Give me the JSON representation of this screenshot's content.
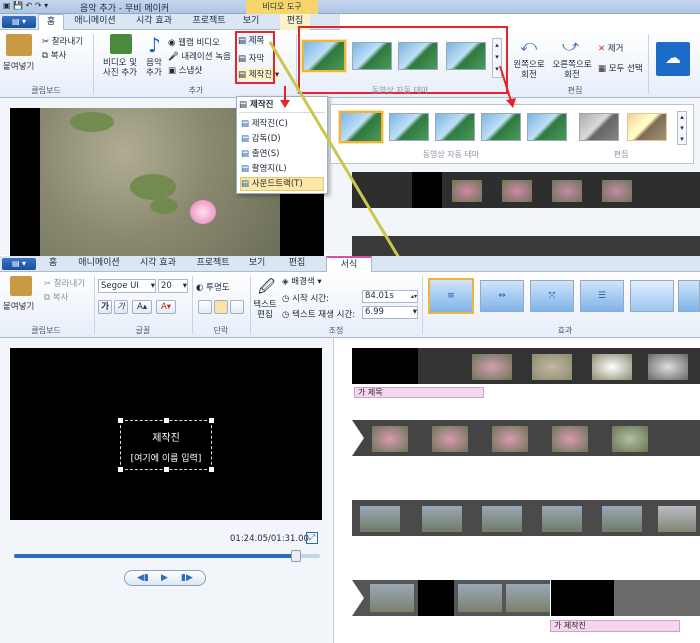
{
  "window": {
    "title": "음악 추가 - 무비 메이커",
    "context_tab": "비디오 도구"
  },
  "top": {
    "tabs": [
      "홈",
      "애니메이션",
      "시각 효과",
      "프로젝트",
      "보기",
      "편집"
    ],
    "clipboard": {
      "paste": "붙여넣기",
      "cut": "잘라내기",
      "copy": "복사",
      "label": "클립보드"
    },
    "add": {
      "add_video": "비디오 및\n사진 추가",
      "music": "음악\n추가",
      "webcam": "웹캠 비디오",
      "narration": "내레이션 녹음",
      "snapshot": "스냅샷",
      "title_btn": "제목",
      "caption_btn": "자막",
      "credits_btn": "제작진",
      "label": "추가"
    },
    "theme_label": "동영상 자동 테마",
    "edit": {
      "rotate_left": "왼쪽으로\n회전",
      "rotate_right": "오른쪽으로\n회전",
      "remove": "제거",
      "select_all": "모두 선택",
      "label": "편집"
    }
  },
  "credits_menu": {
    "header": "제작진",
    "items": [
      "제작진(C)",
      "감독(D)",
      "출연(S)",
      "촬영지(L)",
      "사운드트랙(T)"
    ]
  },
  "expanded": {
    "theme_label": "동영상 자동 테마",
    "edit_label": "편집"
  },
  "bottom": {
    "tabs": [
      "홈",
      "애니메이션",
      "시각 효과",
      "프로젝트",
      "보기",
      "편집",
      "서식"
    ],
    "clipboard": {
      "paste": "붙여넣기",
      "cut": "잘라내기",
      "copy": "복사",
      "label": "클립보드"
    },
    "font": {
      "family": "Segoe UI",
      "size": "20",
      "bold": "가",
      "italic": "가",
      "label": "글꼴"
    },
    "paragraph": {
      "transparency": "투명도",
      "label": "단락"
    },
    "adjust": {
      "text_edit": "텍스트\n편집",
      "bg_color": "배경색",
      "start_time_label": "시작 시간:",
      "start_time": "84.01s",
      "duration_label": "텍스트 재생 시간:",
      "duration": "6.99",
      "label": "조정"
    },
    "effects_label": "효과"
  },
  "preview": {
    "credit_title": "제작진",
    "credit_line": "[여기에 이름 입력]",
    "time": "01:24.05/01:31.00",
    "progress": 0.92
  },
  "captions": {
    "title_clip": "가 제목",
    "credits_clip": "가 제작진"
  },
  "colors": {
    "accent": "#1b4f9e",
    "highlight": "#f0b43a",
    "red": "#e2262a",
    "arrow": "#c8c84a"
  }
}
